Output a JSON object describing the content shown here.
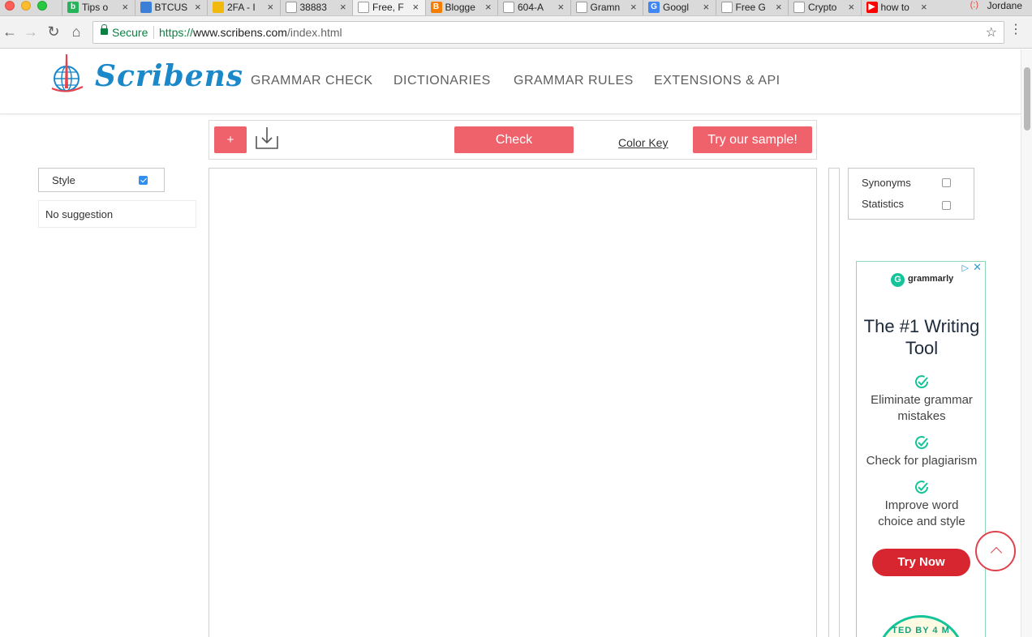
{
  "browser": {
    "tabs": [
      {
        "title": "Tips o",
        "favicon": "b",
        "color": "#27b35a"
      },
      {
        "title": "BTCUS",
        "favicon": "",
        "color": "#3b7fd9"
      },
      {
        "title": "2FA - I",
        "favicon": "",
        "color": "#f0b90b"
      },
      {
        "title": "38883",
        "favicon": "",
        "color": "#ffffff"
      },
      {
        "title": "Free, F",
        "favicon": "",
        "color": "#ffffff"
      },
      {
        "title": "Blogge",
        "favicon": "B",
        "color": "#f57d00"
      },
      {
        "title": "604-A",
        "favicon": "",
        "color": "#ffffff"
      },
      {
        "title": "Gramn",
        "favicon": "",
        "color": "#ffffff"
      },
      {
        "title": "Googl",
        "favicon": "G",
        "color": "#4285f4"
      },
      {
        "title": "Free G",
        "favicon": "",
        "color": "#ffffff"
      },
      {
        "title": "Crypto",
        "favicon": "",
        "color": "#ffffff"
      },
      {
        "title": "how to",
        "favicon": "▶",
        "color": "#ff0000"
      }
    ],
    "active_tab_index": 4,
    "profile_name": "Jordane",
    "secure_label": "Secure",
    "url_scheme": "https://",
    "url_host": "www.scribens.com",
    "url_path": "/index.html"
  },
  "site": {
    "logo_text": "Scribens",
    "nav": [
      "GRAMMAR CHECK",
      "DICTIONARIES",
      "GRAMMAR RULES",
      "EXTENSIONS & API"
    ]
  },
  "actions": {
    "plus_label": "+",
    "check_label": "Check",
    "color_key_label": "Color Key",
    "sample_label": "Try our sample!"
  },
  "left_panel": {
    "style_label": "Style",
    "style_checked": true,
    "suggestion_text": "No suggestion"
  },
  "right_panel": {
    "synonyms_label": "Synonyms",
    "statistics_label": "Statistics"
  },
  "ad": {
    "brand": "grammarly",
    "headline": "The #1 Writing Tool",
    "features": [
      "Eliminate grammar mistakes",
      "Check for plagiarism",
      "Improve word choice and style"
    ],
    "cta": "Try Now",
    "badge_text": "TED BY 4 M"
  },
  "colors": {
    "accent": "#f0626b",
    "logo_blue": "#1a88c9",
    "grammarly_green": "#15c39a",
    "cta_red": "#d7262f"
  }
}
